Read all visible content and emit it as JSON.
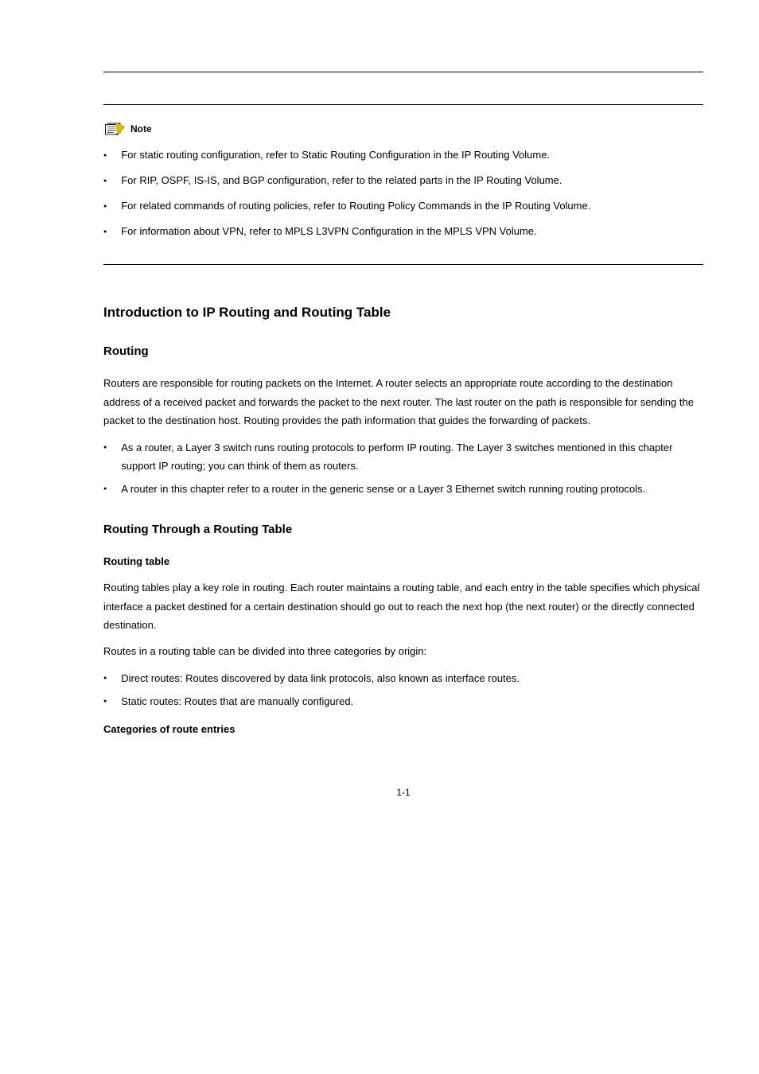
{
  "note": {
    "label": "Note",
    "items": [
      "For static routing configuration, refer to Static Routing Configuration in the IP Routing Volume.",
      "For RIP, OSPF, IS-IS, and BGP configuration, refer to the related parts in the IP Routing Volume.",
      "For related commands of routing policies, refer to Routing Policy Commands in the IP Routing Volume.",
      "For information about VPN, refer to MPLS L3VPN Configuration in the MPLS VPN Volume."
    ]
  },
  "section": {
    "title": "Introduction to IP Routing and Routing Table",
    "sub1": {
      "title": "Routing",
      "para1": "Routers are responsible for routing packets on the Internet. A router selects an appropriate route according to the destination address of a received packet and forwards the packet to the next router. The last router on the path is responsible for sending the packet to the destination host. Routing provides the path information that guides the forwarding of packets.",
      "bullets": [
        "As a router, a Layer 3 switch runs routing protocols to perform IP routing. The Layer 3 switches mentioned in this chapter support IP routing; you can think of them as routers.",
        "A router in this chapter refer to a router in the generic sense or a Layer 3 Ethernet switch running routing protocols."
      ]
    },
    "sub2": {
      "title": "Routing Through a Routing Table",
      "h_rt": "Routing table",
      "para_rt": "Routing tables play a key role in routing. Each router maintains a routing table, and each entry in the table specifies which physical interface a packet destined for a certain destination should go out to reach the next hop (the next router) or the directly connected destination.",
      "para_rt2": "Routes in a routing table can be divided into three categories by origin:",
      "rt_bullets": [
        "Direct routes: Routes discovered by data link protocols, also known as interface routes.",
        "Static routes: Routes that are manually configured."
      ],
      "h_cat": "Categories of route entries"
    }
  },
  "page_number": "1-1",
  "italic_map": {
    "note0": [
      "Static Routing Configuration",
      "IP Routing Volume"
    ],
    "note1_A": "IP Routing Volume",
    "note2": [
      "Routing Policy Commands",
      "IP Routing Volume"
    ],
    "note3": [
      "MPLS L3VPN Configuration",
      "MPLS VPN Volume"
    ]
  }
}
